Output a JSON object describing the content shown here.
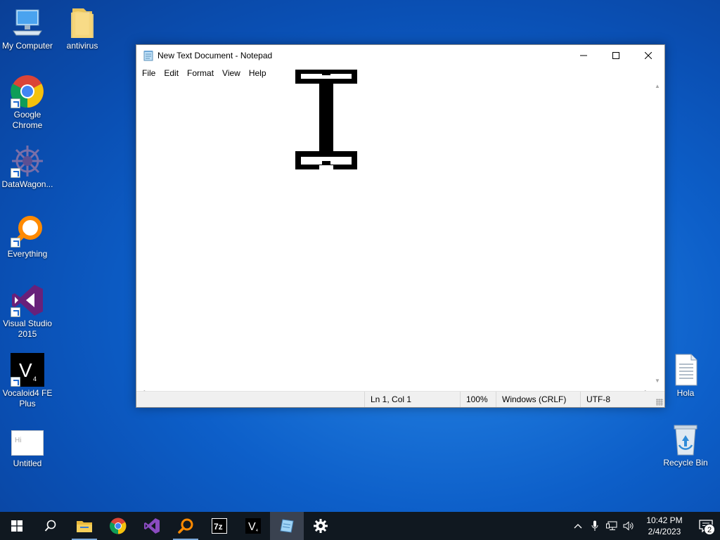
{
  "desktop": {
    "icons_left": [
      {
        "label": "My Computer"
      },
      {
        "label": "antivirus"
      },
      {
        "label": "Google Chrome"
      },
      {
        "label": "DataWagon..."
      },
      {
        "label": "Everything"
      },
      {
        "label": "Visual Studio 2015"
      },
      {
        "label": "Vocaloid4 FE Plus"
      },
      {
        "label": "Untitled",
        "thumb_text": "Hi"
      }
    ],
    "icons_right": [
      {
        "label": "Hola"
      },
      {
        "label": "Recycle Bin"
      }
    ]
  },
  "notepad": {
    "title": "New Text Document - Notepad",
    "menu": [
      "File",
      "Edit",
      "Format",
      "View",
      "Help"
    ],
    "content": "",
    "status": {
      "position": "Ln 1, Col 1",
      "zoom": "100%",
      "line_ending": "Windows (CRLF)",
      "encoding": "UTF-8"
    }
  },
  "taskbar": {
    "apps": [
      "start",
      "search",
      "file-explorer",
      "chrome",
      "visual-studio",
      "everything",
      "7zip",
      "vocaloid",
      "notepad",
      "settings"
    ],
    "tray": {
      "time": "10:42 PM",
      "date": "2/4/2023",
      "notification_count": "2"
    }
  },
  "colors": {
    "desktop_blue": "#0d5fc9",
    "taskbar": "#101820",
    "vs_purple": "#68217a",
    "everything_orange": "#ff8a00"
  }
}
